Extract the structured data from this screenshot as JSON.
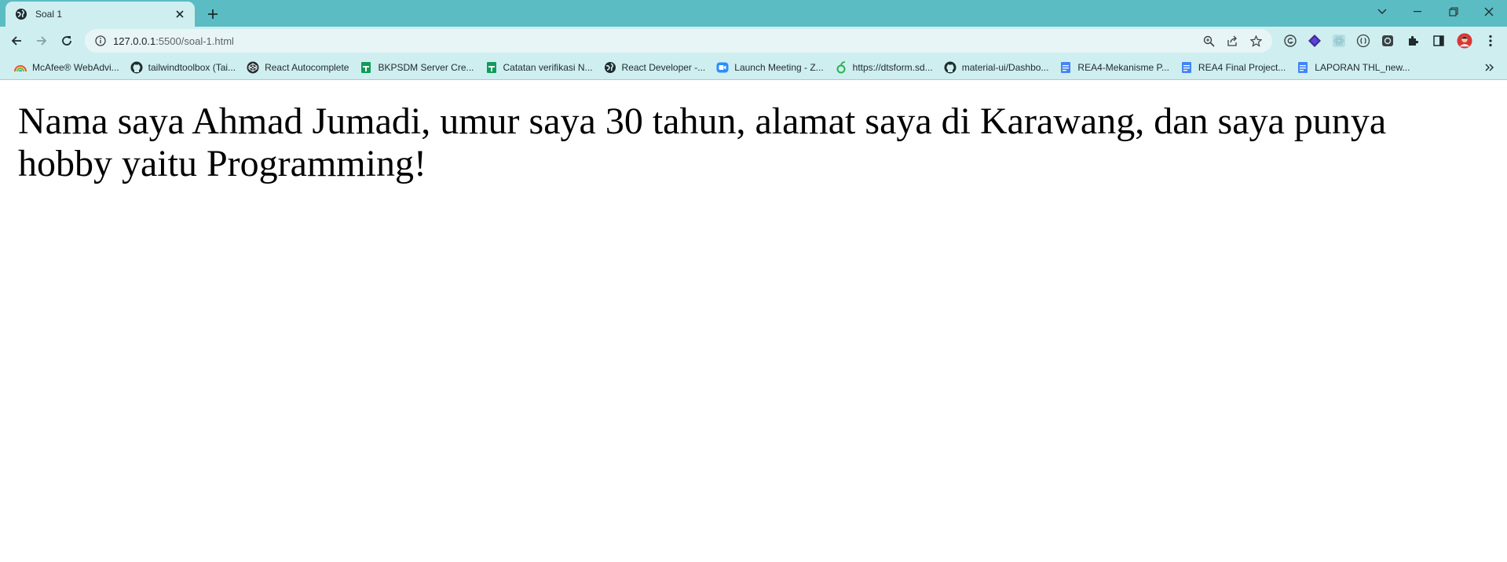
{
  "tab": {
    "title": "Soal 1"
  },
  "address_bar": {
    "host": "127.0.0.1",
    "path": ":5500/soal-1.html"
  },
  "bookmarks": [
    {
      "label": "McAfee® WebAdvi...",
      "icon": "mcafee-icon"
    },
    {
      "label": "tailwindtoolbox (Tai...",
      "icon": "github-icon"
    },
    {
      "label": "React Autocomplete",
      "icon": "codepen-icon"
    },
    {
      "label": "BKPSDM Server Cre...",
      "icon": "sheets-icon"
    },
    {
      "label": "Catatan verifikasi N...",
      "icon": "sheets-icon"
    },
    {
      "label": "React Developer -...",
      "icon": "globe-icon"
    },
    {
      "label": "Launch Meeting - Z...",
      "icon": "zoom-icon"
    },
    {
      "label": "https://dtsform.sd...",
      "icon": "leaf-icon"
    },
    {
      "label": "material-ui/Dashbo...",
      "icon": "github-icon"
    },
    {
      "label": "REA4-Mekanisme P...",
      "icon": "docs-icon"
    },
    {
      "label": "REA4 Final Project...",
      "icon": "docs-icon"
    },
    {
      "label": "LAPORAN THL_new...",
      "icon": "docs-icon"
    }
  ],
  "page": {
    "text": "Nama saya Ahmad Jumadi, umur saya 30 tahun, alamat saya di Karawang, dan saya punya hobby yaitu Programming!"
  },
  "colors": {
    "tabstrip": "#5bbcc3",
    "toolbar": "#cfeef0",
    "omnibox": "#e8f5f6"
  }
}
